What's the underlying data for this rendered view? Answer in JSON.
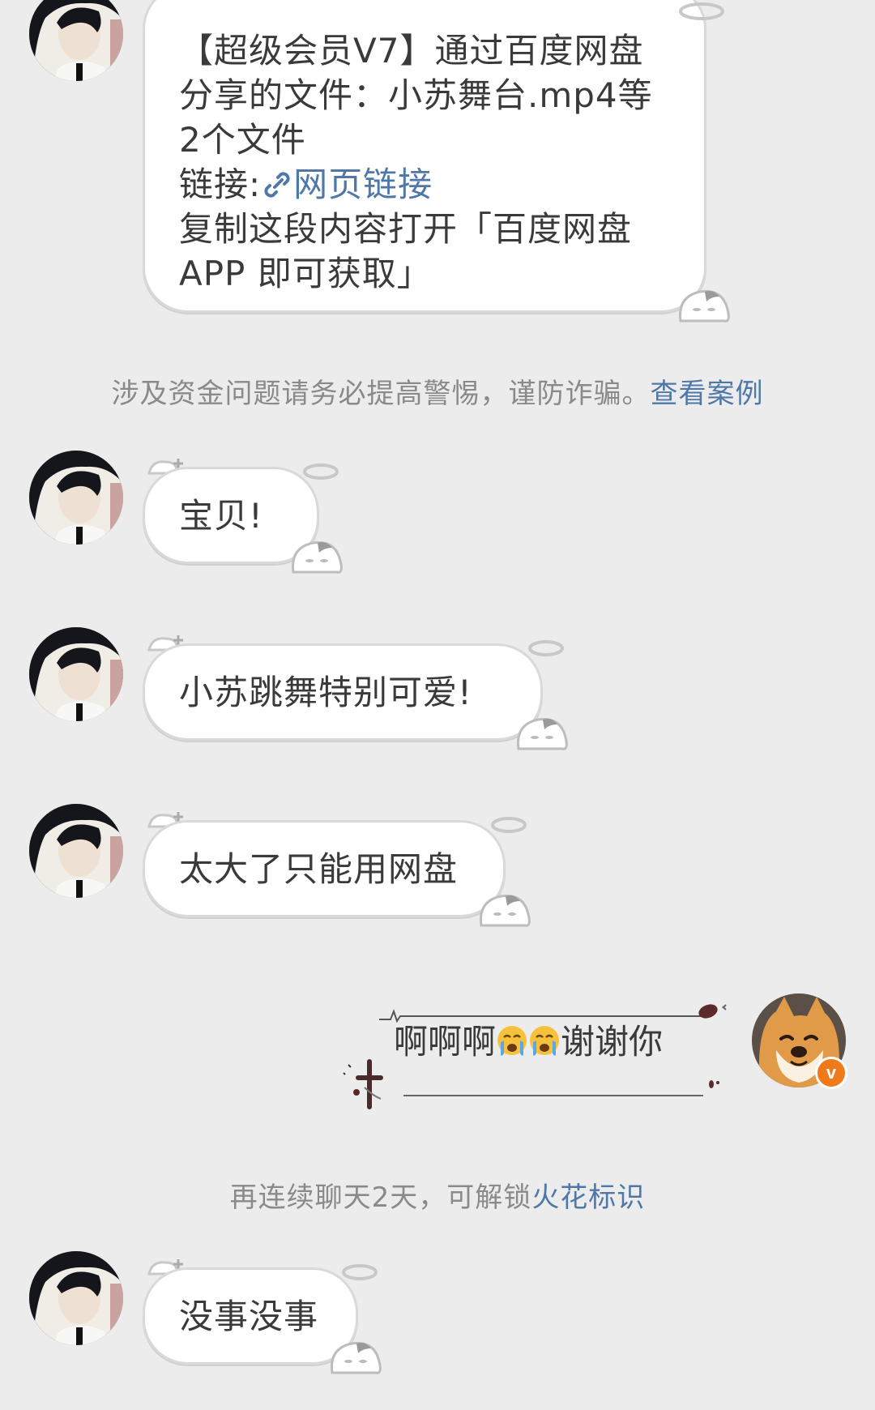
{
  "messages": {
    "m1": {
      "line1": "【超级会员V7】通过百度网盘",
      "line2": "分享的文件：小苏舞台.mp4等",
      "line3": "2个文件",
      "line4_prefix": "链接:",
      "line4_link": "网页链接",
      "line5": "复制这段内容打开「百度网盘",
      "line6": "APP 即可获取」"
    },
    "m2": "宝贝!",
    "m3": "小苏跳舞特别可爱!",
    "m4": "太大了只能用网盘",
    "m5_prefix": "啊啊啊",
    "m5_suffix": "谢谢你",
    "m6": "没事没事"
  },
  "system": {
    "warning_text": "涉及资金问题请务必提高警惕，谨防诈骗。",
    "warning_link": "查看案例",
    "spark_text": "再连续聊天2天，可解锁",
    "spark_link": "火花标识"
  },
  "icons": {
    "link": "link-icon",
    "crying_emoji": "crying-face-icon",
    "verified_badge": "verified-v-badge"
  },
  "colors": {
    "background": "#ececec",
    "link": "#4f78a8",
    "badge": "#f07a1a"
  }
}
